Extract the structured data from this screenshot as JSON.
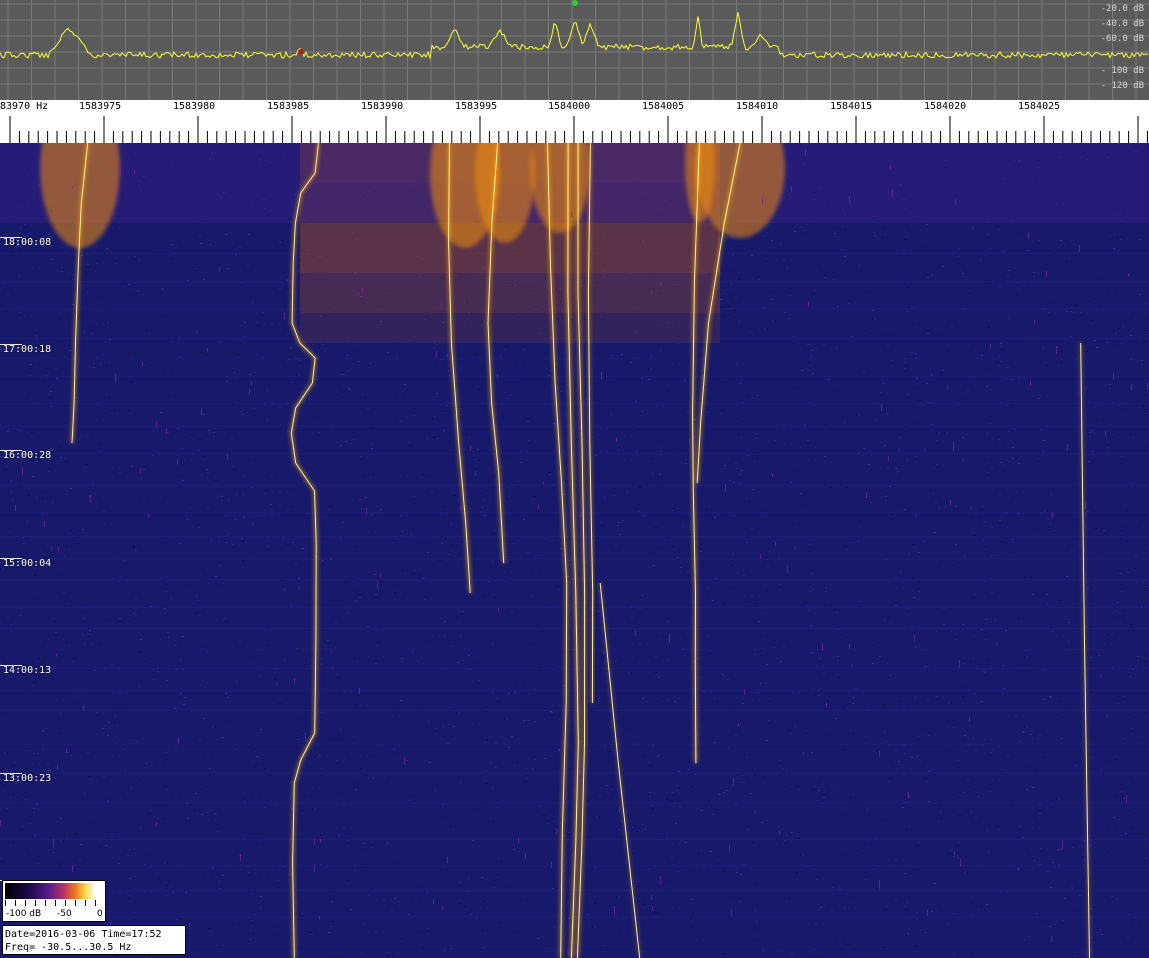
{
  "spectrum": {
    "db_labels": [
      "-20.0 dB",
      "-40.0 dB",
      "-60.0 dB",
      "- 100 dB",
      "- 120 dB"
    ],
    "trace_color": "#ffff33"
  },
  "frequency_scale": {
    "labels": [
      "83970 Hz",
      "1583975",
      "1583980",
      "1583985",
      "1583990",
      "1583995",
      "1584000",
      "1584005",
      "1584010",
      "1584015",
      "1584020",
      "1584025"
    ]
  },
  "waterfall": {
    "time_labels": [
      "18:00:08",
      "17:00:18",
      "16:00:28",
      "15:00:04",
      "14:00:13",
      "13:00:23"
    ],
    "background": "#171a6b",
    "signal_color": "#ffb000"
  },
  "colorbar": {
    "labels": [
      "-100 dB",
      "-50",
      "0"
    ]
  },
  "info": {
    "date_time": "Date=2016-03-06 Time=17:52",
    "freq_range": "Freq= -30.5...30.5 Hz"
  }
}
